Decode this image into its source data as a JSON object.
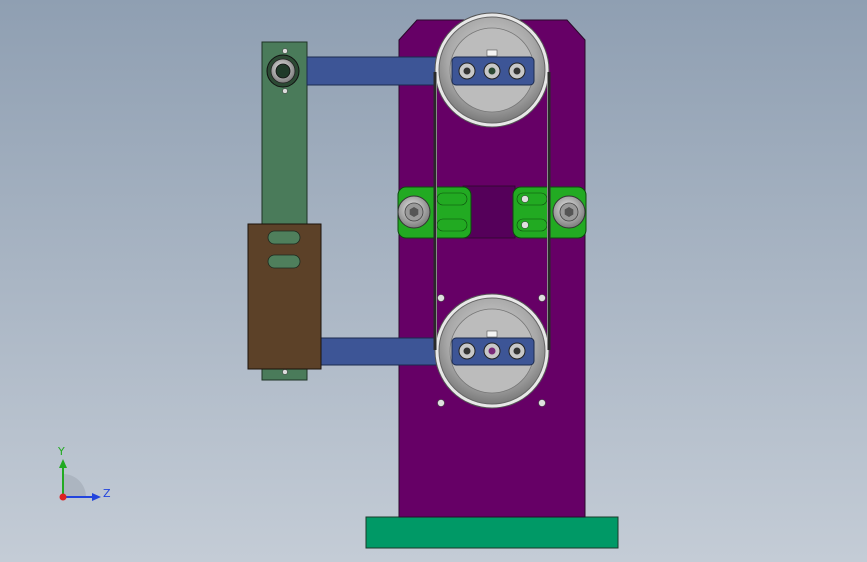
{
  "viewport": {
    "background_top": "#8f9fb2",
    "background_bottom": "#c4ccd6"
  },
  "colors": {
    "base_plate": "#009966",
    "main_plate": "#660066",
    "vertical_bar": "#4a7b5a",
    "slider_block": "#5c4128",
    "arm": "#3d5596",
    "tensioner": "#22aa22",
    "pulley": "#b3b3b3",
    "belt": "#333333"
  },
  "triad": {
    "axis_y": "Y",
    "axis_z": "Z",
    "y_color": "#22aa22",
    "z_color": "#2244dd",
    "x_color": "#dd2222"
  }
}
